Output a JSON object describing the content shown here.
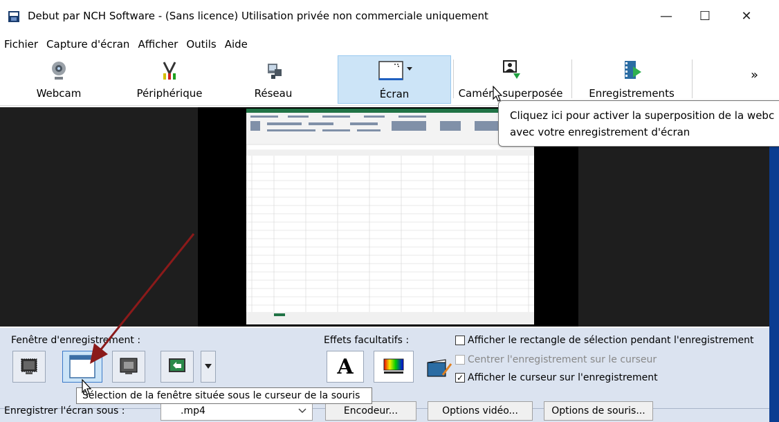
{
  "window": {
    "title": "Debut par NCH Software - (Sans licence) Utilisation privée non commerciale uniquement",
    "minimize": "—",
    "maximize": "☐",
    "close": "✕"
  },
  "menu": [
    "Fichier",
    "Capture d'écran",
    "Afficher",
    "Outils",
    "Aide"
  ],
  "toolbar": {
    "items": [
      {
        "label": "Webcam",
        "icon": "webcam-icon"
      },
      {
        "label": "Périphérique",
        "icon": "device-cable-icon"
      },
      {
        "label": "Réseau",
        "icon": "network-icon"
      },
      {
        "label": "Écran",
        "icon": "screen-icon",
        "selected": true
      },
      {
        "label": "Caméra superposée",
        "icon": "overlay-camera-icon"
      },
      {
        "label": "Enregistrements",
        "icon": "recordings-icon"
      }
    ],
    "more": "»"
  },
  "tooltip_top": {
    "line1": "Cliquez ici pour activer la superposition de la webc",
    "line2": "avec votre enregistrement d'écran"
  },
  "bottom": {
    "recording_window_label": "Fenêtre d'enregistrement :",
    "effects_label": "Effets facultatifs :",
    "text_effect": "A",
    "checkboxes": [
      {
        "label": "Afficher le rectangle de sélection pendant l'enregistrement",
        "checked": false,
        "enabled": true
      },
      {
        "label": "Centrer l'enregistrement sur le curseur",
        "checked": false,
        "enabled": false
      },
      {
        "label": "Afficher le curseur sur l'enregistrement",
        "checked": true,
        "enabled": true
      }
    ],
    "tooltip": "Sélection de la fenêtre située sous le curseur de la souris",
    "save_as_label": "Enregistrer l'écran sous :",
    "format": ".mp4",
    "encoder_button": "Encodeur...",
    "video_options_button": "Options vidéo...",
    "mouse_options_button": "Options de souris..."
  },
  "colors": {
    "selected_toolbar": "#cce4f7",
    "bottom_panel": "#dbe3f0",
    "annotation_arrow": "#8b1a1a"
  }
}
